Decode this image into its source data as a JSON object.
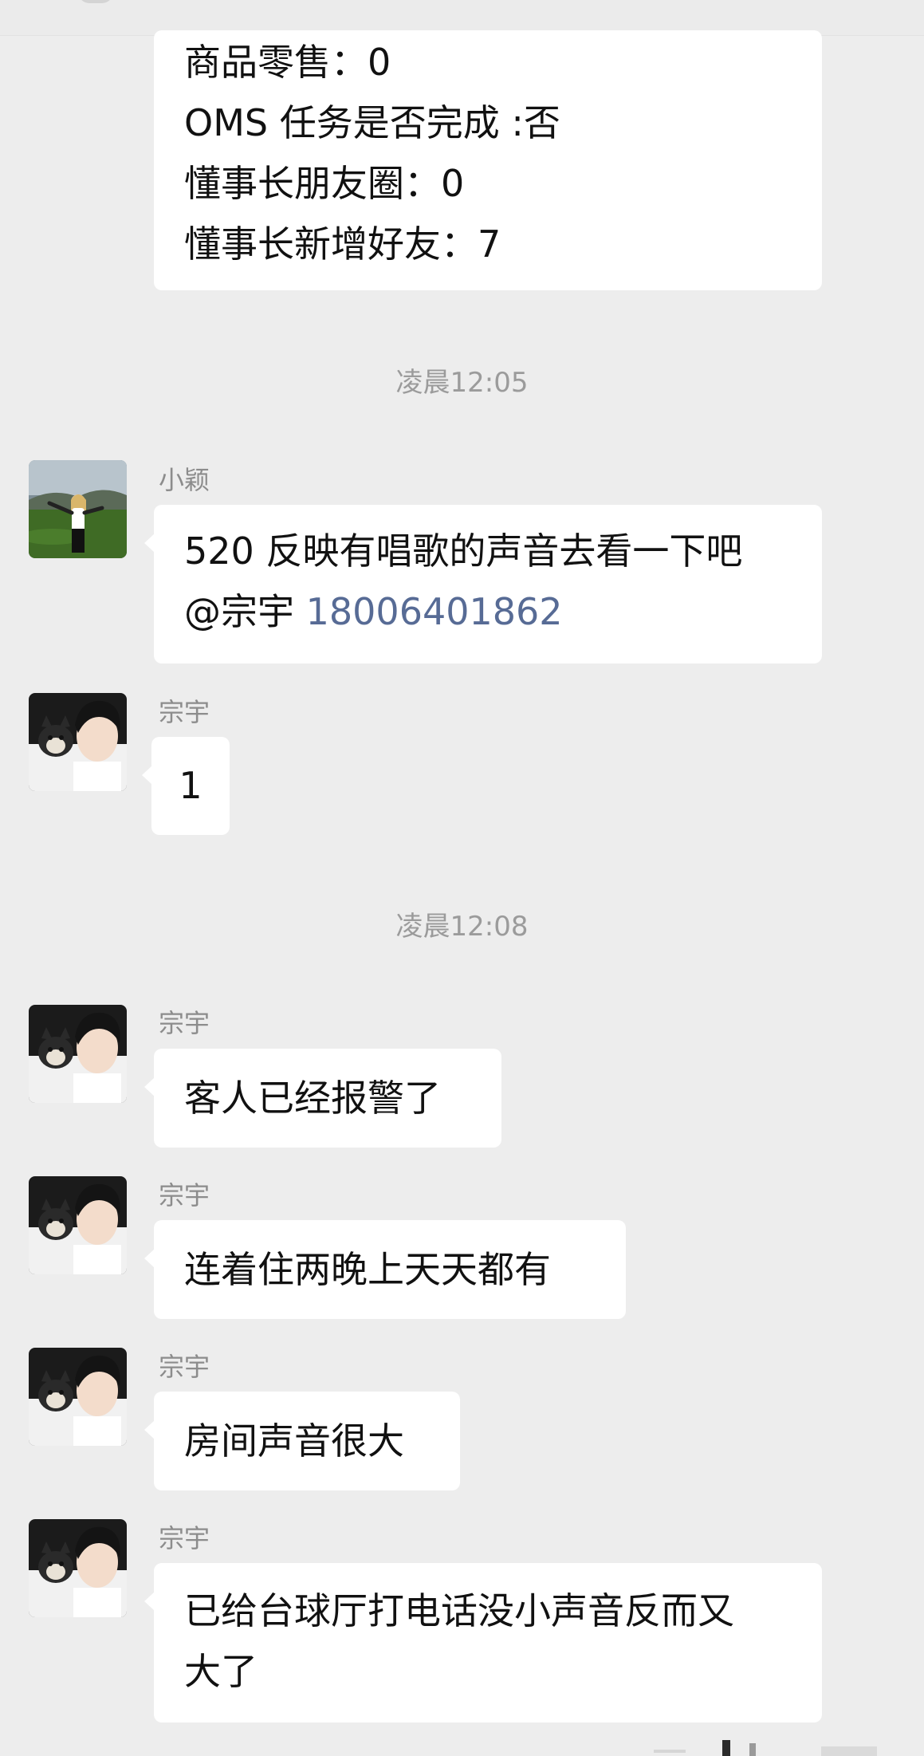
{
  "first_message": {
    "lines": [
      "商品零售：0",
      "OMS 任务是否完成 :否",
      "懂事长朋友圈：0",
      "懂事长新增好友：7"
    ]
  },
  "messages": [
    {
      "timestamp": "凌晨12:05",
      "sender": "小颖",
      "avatar_icon": "woman-on-hillside-avatar",
      "text_prefix": "520 反映有唱歌的声音去看一下吧",
      "mention": "@宗宇 ",
      "phone": "18006401862"
    },
    {
      "sender": "宗宇",
      "avatar_icon": "man-with-dog-avatar",
      "text": "1"
    },
    {
      "timestamp": "凌晨12:08",
      "sender": "宗宇",
      "avatar_icon": "man-with-dog-avatar",
      "text": "客人已经报警了"
    },
    {
      "sender": "宗宇",
      "avatar_icon": "man-with-dog-avatar",
      "text": "连着住两晚上天天都有"
    },
    {
      "sender": "宗宇",
      "avatar_icon": "man-with-dog-avatar",
      "text": "房间声音很大"
    },
    {
      "sender": "宗宇",
      "avatar_icon": "man-with-dog-avatar",
      "lines": [
        "已给台球厅打电话没小声音反而又",
        "大了"
      ]
    }
  ],
  "colors": {
    "background": "#ededed",
    "bubble": "#ffffff",
    "link": "#576b95",
    "meta_text": "#9b9b9b"
  }
}
